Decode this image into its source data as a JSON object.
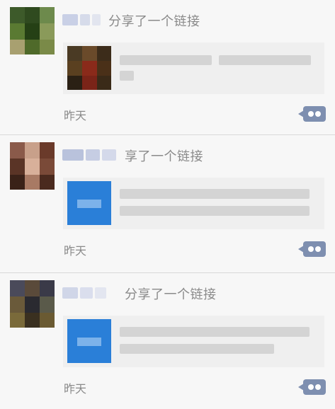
{
  "colors": {
    "background": "#f7f7f7",
    "text_secondary": "#8a8a8a",
    "link_card": "#efefef",
    "link_icon_blue": "#2a7fd8",
    "comment_button": "#7e8fb0"
  },
  "moments": [
    {
      "action": "分享了一个链接",
      "time": "昨天",
      "thumb": "photo",
      "comment_icon": "comment-bubble-icon"
    },
    {
      "action": "享了一个链接",
      "time": "昨天",
      "thumb": "link-icon",
      "comment_icon": "comment-bubble-icon"
    },
    {
      "action": "分享了一个链接",
      "time": "昨天",
      "thumb": "link-icon",
      "comment_icon": "comment-bubble-icon"
    }
  ]
}
